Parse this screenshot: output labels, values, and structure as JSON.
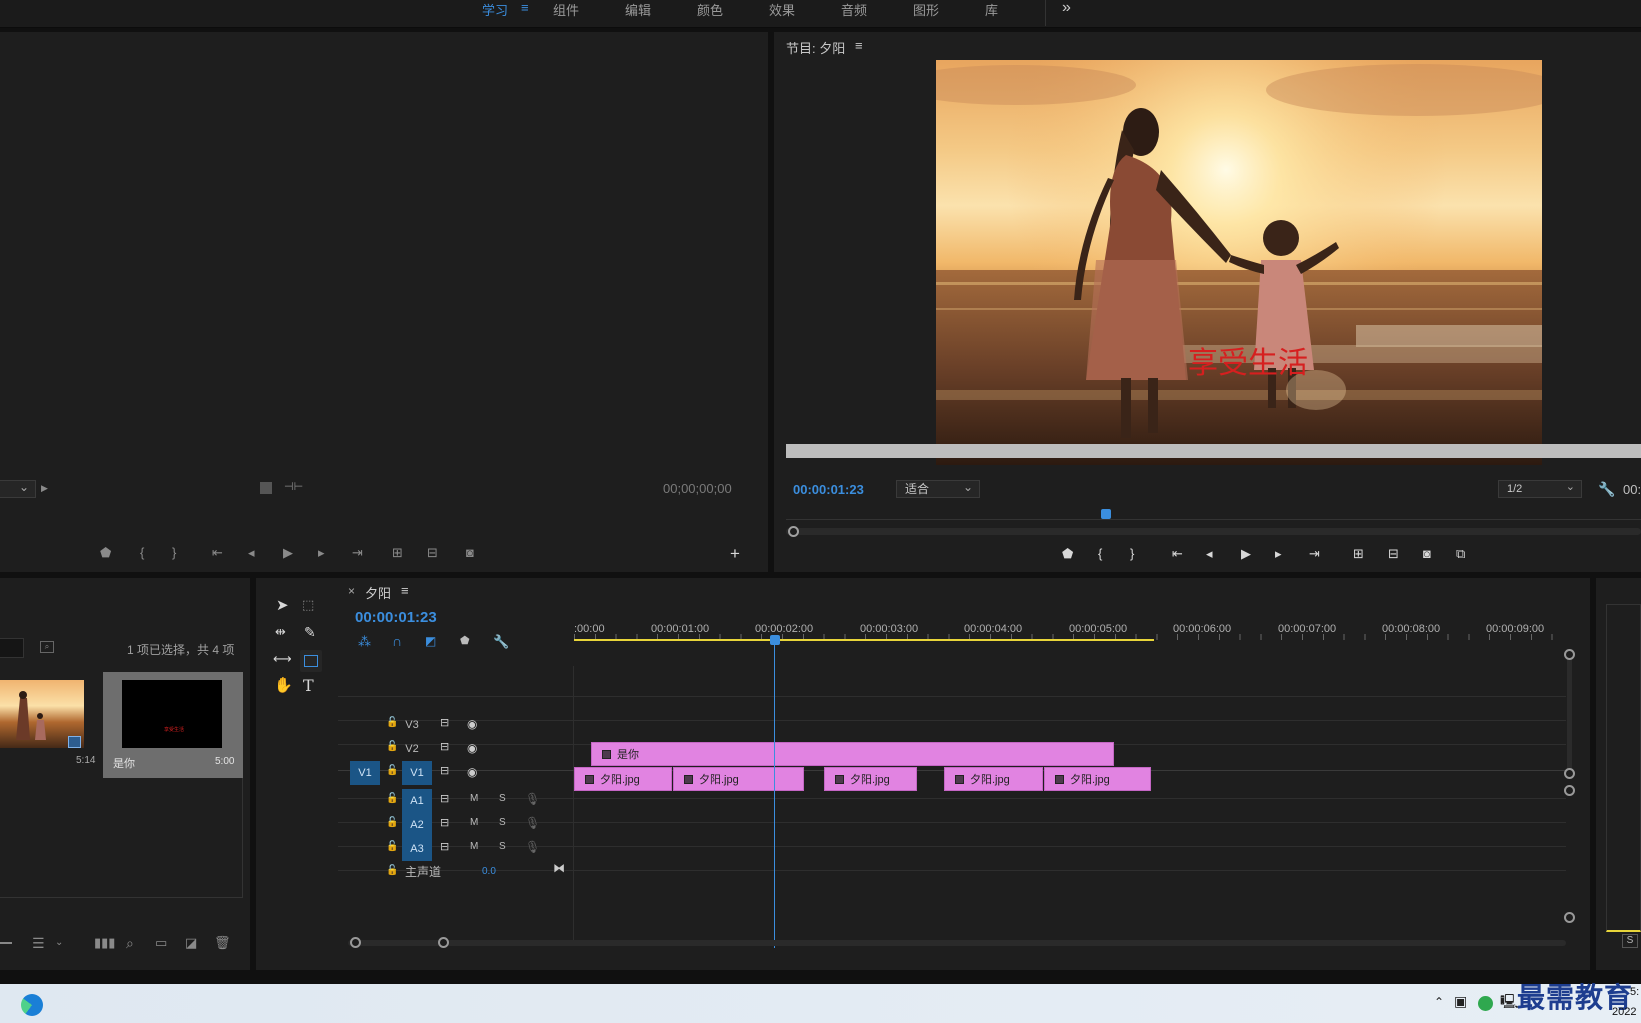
{
  "workspace": {
    "tabs": [
      {
        "label": "学习",
        "active": true
      },
      {
        "label": "组件"
      },
      {
        "label": "编辑"
      },
      {
        "label": "颜色"
      },
      {
        "label": "效果"
      },
      {
        "label": "音频"
      },
      {
        "label": "图形"
      },
      {
        "label": "库"
      }
    ],
    "menu_icon": "≡",
    "more_icon": "»"
  },
  "source_monitor": {
    "timecode": "00;00;00;00"
  },
  "program_monitor": {
    "title": "节目: 夕阳",
    "menu_icon": "≡",
    "timecode": "00:00:01:23",
    "fit": "适合",
    "resolution": "1/2",
    "timecode_right": "00:",
    "overlay_text": "享受生活"
  },
  "project": {
    "selection_status": "1 项已选择，共 4 项",
    "items": [
      {
        "duration": "5:14"
      },
      {
        "name": "是你",
        "duration": "5:00",
        "thumb_text": "享受生活"
      }
    ]
  },
  "timeline": {
    "close": "×",
    "sequence_name": "夕阳",
    "menu_icon": "≡",
    "timecode": "00:00:01:23",
    "ruler_labels": [
      ":00:00",
      "00:00:01:00",
      "00:00:02:00",
      "00:00:03:00",
      "00:00:04:00",
      "00:00:05:00",
      "00:00:06:00",
      "00:00:07:00",
      "00:00:08:00",
      "00:00:09:00"
    ],
    "tracks": {
      "v3": "V3",
      "v2": "V2",
      "v1": "V1",
      "v1_src": "V1",
      "a1": "A1",
      "a2": "A2",
      "a3": "A3",
      "mute": "M",
      "solo": "S",
      "master": "主声道",
      "master_value": "0.0"
    },
    "clips_v2": [
      {
        "label": "是你"
      }
    ],
    "clips_v1": [
      {
        "label": "夕阳.jpg"
      },
      {
        "label": "夕阳.jpg"
      },
      {
        "label": "夕阳.jpg"
      },
      {
        "label": "夕阳.jpg"
      },
      {
        "label": "夕阳.jpg"
      }
    ]
  },
  "audio_meter": {
    "solo": "S"
  },
  "taskbar": {
    "watermark": "最需教育",
    "clock_fragment": "5:",
    "date_fragment": "2022"
  }
}
